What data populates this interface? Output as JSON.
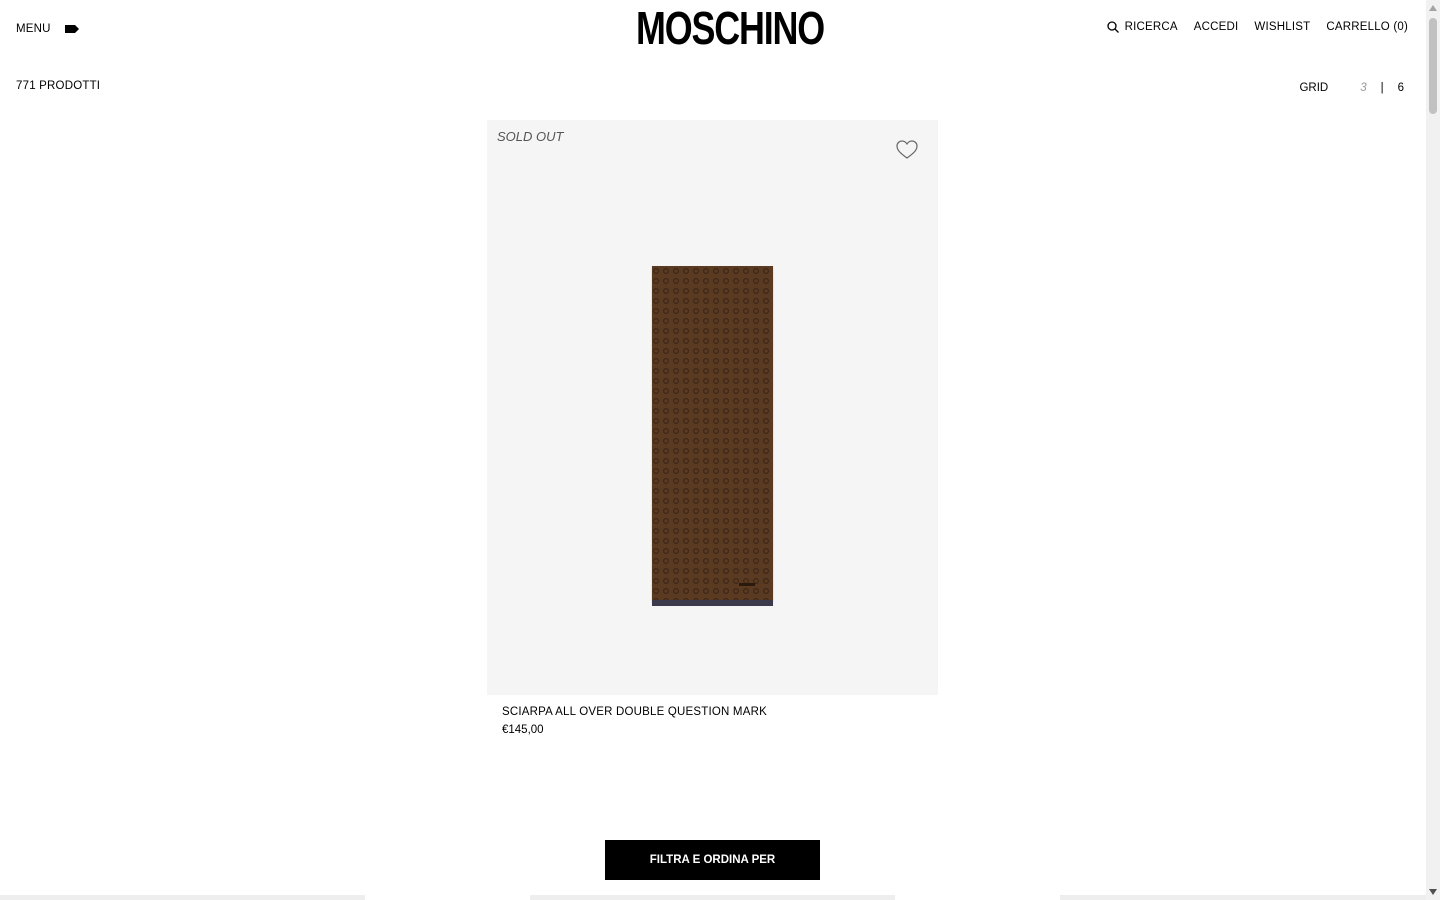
{
  "header": {
    "menu_label": "MENU",
    "logo_text": "MOSCHINO",
    "search_label": "RICERCA",
    "login_label": "ACCEDI",
    "wishlist_label": "WISHLIST",
    "cart_label": "CARRELLO (0)"
  },
  "listing": {
    "count_label": "771 PRODOTTI",
    "grid_label": "GRID",
    "grid_option_3": "3",
    "grid_separator": "|",
    "grid_option_6": "6"
  },
  "product": {
    "badge": "SOLD OUT",
    "name": "SCIARPA ALL OVER DOUBLE QUESTION MARK",
    "price": "€145,00",
    "image_colors": {
      "background": "#f5f5f5",
      "scarf": "#5a3a22",
      "pattern": "#3e2716",
      "fringe": "#3a3a4a"
    }
  },
  "filter_button_label": "FILTRA E ORDINA PER",
  "icons": [
    "tag-icon",
    "search-icon",
    "heart-icon",
    "scarf-image"
  ]
}
